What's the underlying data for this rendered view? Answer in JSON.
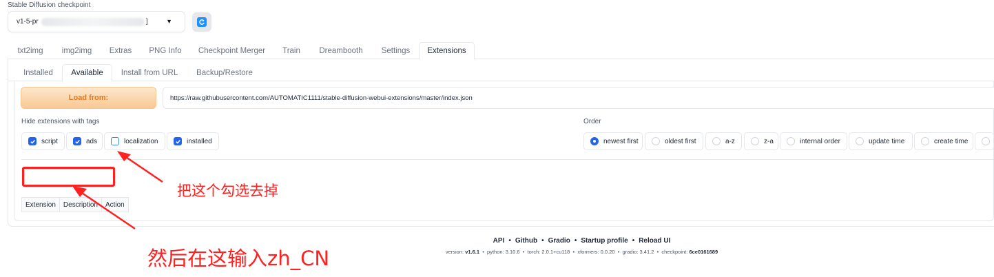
{
  "checkpoint": {
    "label": "Stable Diffusion checkpoint",
    "value_prefix": "v1-5-pr",
    "value_suffix": "]",
    "caret": "▼",
    "refresh_icon": "refresh-icon"
  },
  "main_tabs": [
    "txt2img",
    "img2img",
    "Extras",
    "PNG Info",
    "Checkpoint Merger",
    "Train",
    "Dreambooth",
    "Settings",
    "Extensions"
  ],
  "main_tab_selected": "Extensions",
  "sub_tabs": [
    "Installed",
    "Available",
    "Install from URL",
    "Backup/Restore"
  ],
  "sub_tab_selected": "Available",
  "load": {
    "button_label": "Load from:",
    "url": "https://raw.githubusercontent.com/AUTOMATIC1111/stable-diffusion-webui-extensions/master/index.json"
  },
  "hide_tags": {
    "label": "Hide extensions with tags",
    "options": [
      {
        "label": "script",
        "checked": true
      },
      {
        "label": "ads",
        "checked": true
      },
      {
        "label": "localization",
        "checked": false
      },
      {
        "label": "installed",
        "checked": true
      }
    ]
  },
  "order": {
    "label": "Order",
    "options": [
      {
        "label": "newest first",
        "selected": true
      },
      {
        "label": "oldest first",
        "selected": false
      },
      {
        "label": "a-z",
        "selected": false
      },
      {
        "label": "z-a",
        "selected": false
      },
      {
        "label": "internal order",
        "selected": false
      },
      {
        "label": "update time",
        "selected": false
      },
      {
        "label": "create time",
        "selected": false
      },
      {
        "label": "",
        "selected": false
      }
    ]
  },
  "search": {
    "value": ""
  },
  "table": {
    "headers": [
      "Extension",
      "Description",
      "Action"
    ]
  },
  "annotations": {
    "uncheck_note": "把这个勾选去掉",
    "input_note": "然后在这输入zh_CN",
    "color": "#ff2020"
  },
  "footer": {
    "links": [
      "API",
      "Github",
      "Gradio",
      "Startup profile",
      "Reload UI"
    ],
    "separator": "•",
    "version_label": "version:",
    "version": "v1.6.1",
    "python": "python: 3.10.6",
    "torch": "torch: 2.0.1+cu118",
    "xformers": "xformers: 0.0.20",
    "gradio": "gradio: 3.41.2",
    "checkpoint_label": "checkpoint:",
    "checkpoint": "6ce0161689"
  },
  "colors": {
    "accent": "#2563eb",
    "load_button_text": "#e0781e",
    "annotation": "#ff2020"
  }
}
